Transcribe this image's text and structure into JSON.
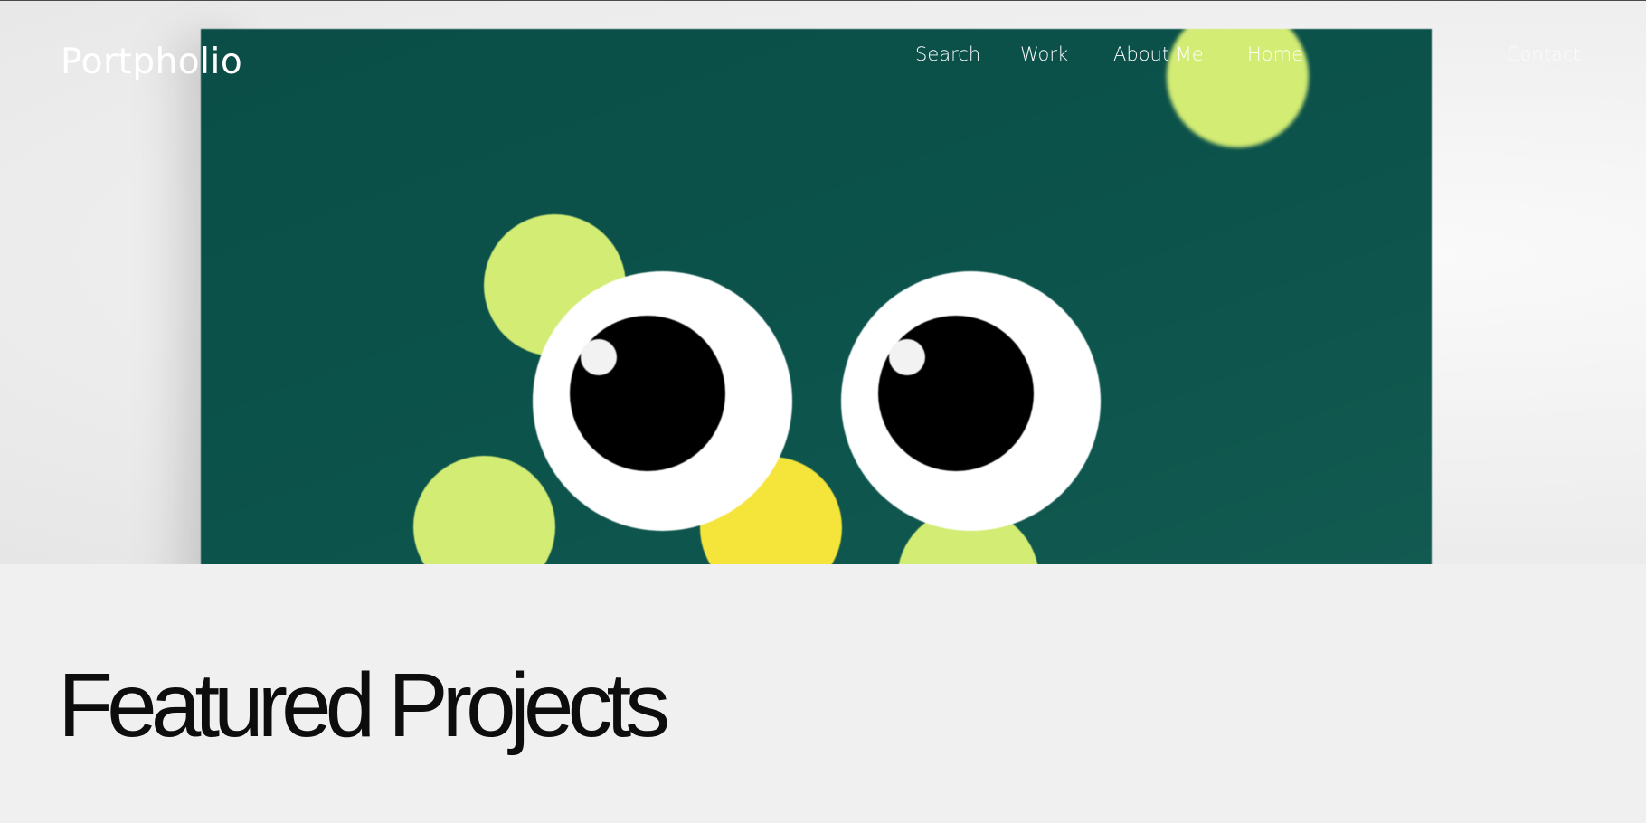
{
  "header": {
    "brand": "Portpholio",
    "nav": {
      "search": "Search",
      "work": "Work",
      "about": "About Me",
      "home": "Home",
      "contact": "Contact"
    }
  },
  "hero": {
    "colors": {
      "background": "#0c534b",
      "lime": "#d2ec74",
      "yellow": "#f5e43a"
    }
  },
  "featured": {
    "title": "Featured Projects"
  }
}
